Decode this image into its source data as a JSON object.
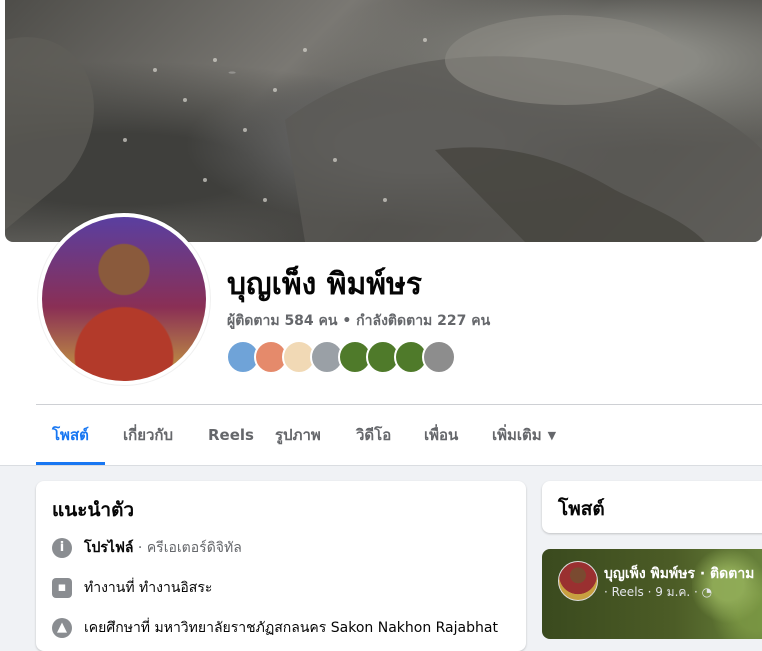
{
  "profile": {
    "name": "บุญเพ็ง พิมพ์ษร",
    "followers_line": "ผู้ติดตาม 584 คน • กำลังติดตาม 227 คน"
  },
  "friends_preview": {
    "colors": [
      "#6fa3d8",
      "#e58a6b",
      "#f1d9b5",
      "#9aa0a6",
      "#4f7a2a",
      "#4f7a2a",
      "#4f7a2a",
      "#8d8d8d"
    ]
  },
  "tabs": [
    {
      "label": "โพสต์",
      "active": true
    },
    {
      "label": "เกี่ยวกับ"
    },
    {
      "label": "Reels"
    },
    {
      "label": "รูปภาพ"
    },
    {
      "label": "วิดีโอ"
    },
    {
      "label": "เพื่อน"
    },
    {
      "label": "เพิ่มเติม"
    }
  ],
  "intro": {
    "title": "แนะนำตัว",
    "profile_label": "โปรไฟล์",
    "profile_category": " · ครีเอเตอร์ดิจิทัล",
    "work_text": "ทำงานที่ ทำงานอิสระ",
    "study_text": "เคยศึกษาที่ มหาวิทยาลัยราชภัฏสกลนคร Sakon Nakhon Rajabhat"
  },
  "posts": {
    "title": "โพสต์",
    "preview_name": "บุญเพ็ง พิมพ์ษร · ติดตาม",
    "preview_sub": "· Reels · 9 ม.ค. · ◔"
  },
  "colors": {
    "accent": "#1877f2",
    "text_secondary": "#65676b",
    "background": "#f0f2f5"
  }
}
